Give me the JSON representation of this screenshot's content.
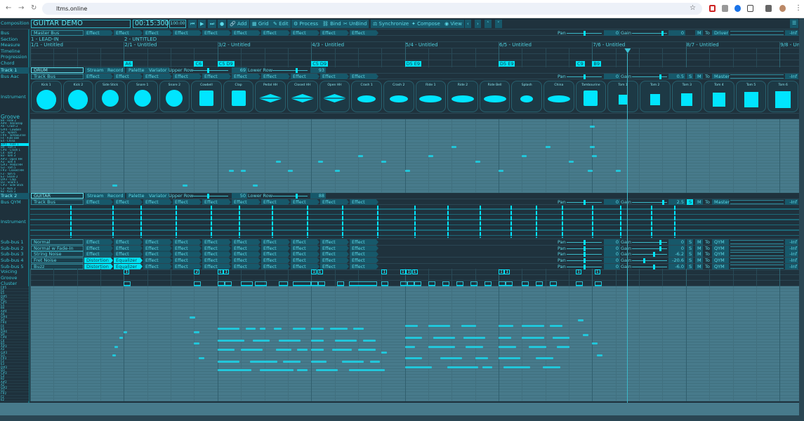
{
  "browser": {
    "url": "ltms.online"
  },
  "toolbar": {
    "label": "Composition",
    "title": "GUITAR DEMO",
    "time": "00:15:300",
    "tempo": "100.00",
    "buttons": [
      "Add",
      "Grid",
      "Edit",
      "Process",
      "Bind",
      "UnBind",
      "Synchronize",
      "Compose",
      "View"
    ]
  },
  "labels": {
    "bus": "Bus",
    "section": "Section",
    "measure": "Measure",
    "timeline": "Timeline",
    "progression": "Progression",
    "chord": "Chord",
    "track1": "Track 1",
    "busaac": "Bus Aac",
    "instrument": "Instrument",
    "groove": "Groove",
    "track2": "Track 2",
    "busqym": "Bus QYM",
    "instrument2": "Instrument",
    "voicing": "Voicing",
    "groove2": "Groove",
    "cluster": "Cluster"
  },
  "master_bus": {
    "name": "Master Bus",
    "effects": [
      "Effect",
      "Effect",
      "Effect",
      "Effect",
      "Effect",
      "Effect",
      "Effect",
      "Effect",
      "Effect",
      "Effect"
    ],
    "pan_label": "Pan",
    "pan": "0",
    "pan_frac": 0.5,
    "gain_label": "Gain",
    "gain": "0",
    "gain_frac": 0.85,
    "m": "M",
    "to": "To",
    "dest": "Driver",
    "level": "-Inf"
  },
  "sections": [
    "1 - LEAD-IN",
    "2 - UNTITLED"
  ],
  "measures": [
    "1/1 - Untitled",
    "2/1 - Untitled",
    "3/2 - Untitled",
    "4/3 - Untitled",
    "5/4 - Untitled",
    "6/5 - Untitled",
    "7/6 - Untitled",
    "8/7 - Untitled",
    "9/8 - Untitled"
  ],
  "playhead_beat": 25.5,
  "chords": [
    {
      "beat": 4,
      "name": "A6"
    },
    {
      "beat": 7,
      "name": "C6"
    },
    {
      "beat": 8,
      "name": "C5 D9"
    },
    {
      "beat": 12,
      "name": "C5 D9"
    },
    {
      "beat": 16,
      "name": "D5 E9"
    },
    {
      "beat": 20,
      "name": "D5 E9"
    },
    {
      "beat": 23.3,
      "name": "C9"
    },
    {
      "beat": 24,
      "name": "B9"
    }
  ],
  "track1": {
    "name": "DRUM",
    "buttons": [
      "Stream",
      "Record",
      "Palette",
      "Variator"
    ],
    "upper_label": "Upper Row",
    "upper": "69",
    "upper_frac": 0.4,
    "lower_label": "Lower Row",
    "lower": "93",
    "lower_frac": 0.65,
    "bus": {
      "name": "Track Bus",
      "effects": [
        "Effect",
        "Effect",
        "Effect",
        "Effect",
        "Effect",
        "Effect",
        "Effect",
        "Effect",
        "Effect",
        "Effect"
      ],
      "pan_label": "Pan",
      "pan": "0",
      "pan_frac": 0.5,
      "gain_label": "Gain",
      "gain": "0.5",
      "gain_frac": 0.8,
      "s": "S",
      "m": "M",
      "to": "To",
      "dest": "Master",
      "level": "-Inf"
    },
    "instruments": [
      {
        "name": "Kick 1",
        "shape": "kick"
      },
      {
        "name": "Kick 2",
        "shape": "kick"
      },
      {
        "name": "Side Stick",
        "shape": "snare"
      },
      {
        "name": "Snare 1",
        "shape": "snare"
      },
      {
        "name": "Snare 2",
        "shape": "snare"
      },
      {
        "name": "Cowbell",
        "shape": "block"
      },
      {
        "name": "Clap",
        "shape": "block"
      },
      {
        "name": "Pedal HH",
        "shape": "hh"
      },
      {
        "name": "Closed HH",
        "shape": "hh"
      },
      {
        "name": "Open HH",
        "shape": "hh"
      },
      {
        "name": "Crash 1",
        "shape": "cym"
      },
      {
        "name": "Crash 2",
        "shape": "cym"
      },
      {
        "name": "Ride 1",
        "shape": "cym"
      },
      {
        "name": "Ride 2",
        "shape": "cym"
      },
      {
        "name": "Ride Bell",
        "shape": "cym"
      },
      {
        "name": "Splash",
        "shape": "cym"
      },
      {
        "name": "China",
        "shape": "cym"
      },
      {
        "name": "Tambourine",
        "shape": "block"
      },
      {
        "name": "Tom 1",
        "shape": "tom"
      },
      {
        "name": "Tom 2",
        "shape": "tom"
      },
      {
        "name": "Tom 3",
        "shape": "tom"
      },
      {
        "name": "Tom 4",
        "shape": "tom"
      },
      {
        "name": "Tom 5",
        "shape": "tom"
      },
      {
        "name": "Tom 6",
        "shape": "tom"
      }
    ],
    "groove_rows": [
      "B4 - Ride 2",
      "A#4 - Vibraslap",
      "A4 - Crash 2",
      "G#4 - Cowbell",
      "G4 - Splash",
      "F#4 - Tambourine",
      "F4 - Ride Bell",
      "E4 - China",
      "D#4 - Ride 1",
      "D4 - Tom 1",
      "C#4 - Crash 1",
      "C4 - Tom 2",
      "B3 - Tom 3",
      "A#3 - Open HH",
      "A3 - Tom 4",
      "G#3 - Pedal HH",
      "G3 - Tom 5",
      "F#3 - Closed HH",
      "F3 - Tom 6",
      "E3 - Snare 2",
      "D#3 - Clap",
      "D3 - Snare 1",
      "C#3 - Side Stick",
      "C3 - Kick 2",
      "B2 - Kick 1"
    ],
    "selected_row": 8,
    "notes": [
      [
        3.5,
        22
      ],
      [
        6.5,
        22
      ],
      [
        9.5,
        22
      ],
      [
        8.5,
        17
      ],
      [
        9,
        17
      ],
      [
        10.5,
        14
      ],
      [
        11,
        17
      ],
      [
        12.3,
        14
      ],
      [
        13,
        17
      ],
      [
        14,
        12
      ],
      [
        15,
        14
      ],
      [
        16,
        17
      ],
      [
        17,
        12
      ],
      [
        18,
        9
      ],
      [
        19,
        14
      ],
      [
        20,
        17
      ],
      [
        21,
        12
      ],
      [
        22,
        9
      ],
      [
        23,
        14
      ],
      [
        23.8,
        17
      ],
      [
        23.9,
        9
      ],
      [
        23.9,
        2
      ],
      [
        24,
        12
      ],
      [
        25,
        17
      ]
    ]
  },
  "track2": {
    "name": "GUITAR",
    "buttons": [
      "Stream",
      "Record",
      "Palette",
      "Variator"
    ],
    "upper_label": "Upper Row",
    "upper": "50",
    "upper_frac": 0.4,
    "lower_label": "Lower Row",
    "lower": "88",
    "lower_frac": 0.65,
    "bus": {
      "name": "Track Bus",
      "effects": [
        "Effect",
        "Effect",
        "Effect",
        "Effect",
        "Effect",
        "Effect",
        "Effect",
        "Effect",
        "Effect",
        "Effect"
      ],
      "pan_label": "Pan",
      "pan": "0",
      "pan_frac": 0.5,
      "gain_label": "Gain",
      "gain": "2.5",
      "gain_frac": 0.88,
      "s": "S",
      "s_active": true,
      "m": "M",
      "to": "To",
      "dest": "Master",
      "level": "-Inf"
    },
    "strings": 6,
    "fret_beats": [
      1.7,
      3.5,
      4.7,
      6.2,
      7.7,
      8.9,
      10.3,
      11.8,
      13.3,
      14.8,
      16.4,
      17.8,
      19.2,
      20.5,
      21.6,
      22.7,
      24,
      25.2,
      26.5,
      27.5
    ],
    "subbuses": [
      {
        "label": "Sub-bus 1",
        "name": "Normal",
        "effects": [
          "Effect",
          "Effect",
          "Effect",
          "Effect",
          "Effect",
          "Effect",
          "Effect",
          "Effect",
          "Effect",
          "Effect"
        ],
        "active": 0,
        "pan": "0",
        "pan_frac": 0.5,
        "gain": "0",
        "gain_frac": 0.8,
        "dest": "QYM",
        "level": "-Inf"
      },
      {
        "label": "Sub-bus 2",
        "name": "Normal w Fade-In",
        "effects": [
          "Effect",
          "Effect",
          "Effect",
          "Effect",
          "Effect",
          "Effect",
          "Effect",
          "Effect",
          "Effect",
          "Effect"
        ],
        "active": 0,
        "pan": "0",
        "pan_frac": 0.5,
        "gain": "0",
        "gain_frac": 0.8,
        "dest": "QYM",
        "level": "-Inf"
      },
      {
        "label": "Sub-bus 3",
        "name": "String Noise",
        "effects": [
          "Effect",
          "Effect",
          "Effect",
          "Effect",
          "Effect",
          "Effect",
          "Effect",
          "Effect",
          "Effect",
          "Effect"
        ],
        "active": 0,
        "pan": "0",
        "pan_frac": 0.5,
        "gain": "-6.2",
        "gain_frac": 0.62,
        "dest": "QYM",
        "level": "-Inf"
      },
      {
        "label": "Sub-bus 4",
        "name": "Fret Noise",
        "effects": [
          "Distortion",
          "Equalizer",
          "Effect",
          "Effect",
          "Effect",
          "Effect",
          "Effect",
          "Effect",
          "Effect",
          "Effect"
        ],
        "active": 2,
        "pan": "0",
        "pan_frac": 0.5,
        "gain": "-20.6",
        "gain_frac": 0.33,
        "dest": "QYM",
        "level": "-Inf"
      },
      {
        "label": "Sub-bus 5",
        "name": "Buzz",
        "effects": [
          "Distortion",
          "Equalizer",
          "Effect",
          "Effect",
          "Effect",
          "Effect",
          "Effect",
          "Effect",
          "Effect",
          "Effect"
        ],
        "active": 2,
        "pan": "0",
        "pan_frac": 0.5,
        "gain": "-6.0",
        "gain_frac": 0.62,
        "dest": "QYM",
        "level": "-Inf"
      }
    ],
    "sub_labels": {
      "pan": "Pan",
      "gain": "Gain",
      "s": "S",
      "m": "M",
      "to": "To"
    },
    "voicings": [
      [
        4,
        "1"
      ],
      [
        7,
        "2"
      ],
      [
        8,
        "1"
      ],
      [
        8.25,
        "1"
      ],
      [
        12,
        "1"
      ],
      [
        12.25,
        "1"
      ],
      [
        15,
        "1"
      ],
      [
        15.8,
        "1"
      ],
      [
        16.05,
        "1"
      ],
      [
        16.3,
        "1"
      ],
      [
        20,
        "1"
      ],
      [
        20.25,
        "1"
      ],
      [
        23.3,
        "1"
      ],
      [
        24.1,
        "1"
      ]
    ],
    "clusters": [
      [
        4,
        0.3
      ],
      [
        7,
        0.3
      ],
      [
        8,
        0.3
      ],
      [
        8.3,
        0.3
      ],
      [
        9,
        0.5
      ],
      [
        9.6,
        0.5
      ],
      [
        10.6,
        0.4
      ],
      [
        11.2,
        0.8
      ],
      [
        12,
        0.3
      ],
      [
        12.3,
        0.3
      ],
      [
        13.1,
        0.3
      ],
      [
        13.6,
        1.2
      ],
      [
        15,
        0.3
      ],
      [
        15.8,
        0.3
      ],
      [
        16.1,
        0.3
      ],
      [
        16.4,
        0.3
      ],
      [
        17,
        0.3
      ],
      [
        17.6,
        0.3
      ],
      [
        18.2,
        0.3
      ],
      [
        18.8,
        0.3
      ],
      [
        19.4,
        0.3
      ],
      [
        20,
        0.3
      ],
      [
        20.3,
        0.3
      ],
      [
        21,
        0.3
      ],
      [
        21.6,
        0.3
      ],
      [
        22.2,
        0.3
      ],
      [
        23.3,
        0.3
      ],
      [
        24.1,
        0.3
      ]
    ],
    "piano_rows": [
      "F#5",
      "F5",
      "E5",
      "D#5",
      "D5",
      "C#5",
      "C5",
      "B4",
      "A#4",
      "A4",
      "G#4",
      "G4",
      "F#4",
      "F4",
      "E4",
      "D#4",
      "D4",
      "C#4",
      "C4",
      "B3",
      "A#3",
      "A3",
      "G#3",
      "G3",
      "F#3",
      "F3",
      "E3",
      "D#3",
      "D3",
      "C#3",
      "C3",
      "B2",
      "A#2",
      "A2",
      "G#2",
      "G2",
      "F#2",
      "F2",
      "E2"
    ],
    "notes": [
      [
        4,
        15,
        0.2
      ],
      [
        3.8,
        17,
        0.2
      ],
      [
        3.6,
        20,
        0.2
      ],
      [
        3.5,
        23,
        0.2
      ],
      [
        6.8,
        10,
        0.3
      ],
      [
        7,
        15,
        0.3
      ],
      [
        7,
        19,
        0.3
      ],
      [
        7.2,
        24,
        0.3
      ],
      [
        8,
        14,
        1
      ],
      [
        9.2,
        14,
        0.5
      ],
      [
        9.8,
        14,
        0.3
      ],
      [
        10.4,
        14,
        0.4
      ],
      [
        11.2,
        14,
        0.6
      ],
      [
        8,
        18,
        1.2
      ],
      [
        9.5,
        18,
        0.8
      ],
      [
        10.6,
        18,
        1
      ],
      [
        8,
        21,
        0.8
      ],
      [
        9,
        21,
        1
      ],
      [
        10.5,
        21,
        0.7
      ],
      [
        11.4,
        21,
        0.5
      ],
      [
        8,
        25,
        1
      ],
      [
        9.4,
        25,
        1.2
      ],
      [
        10.8,
        25,
        0.8
      ],
      [
        8,
        28,
        1.5
      ],
      [
        9.8,
        28,
        1.5
      ],
      [
        11.4,
        28,
        0.5
      ],
      [
        12,
        14,
        0.6
      ],
      [
        12.8,
        14,
        0.8
      ],
      [
        13.8,
        14,
        0.5
      ],
      [
        12,
        18,
        0.6
      ],
      [
        13,
        18,
        1
      ],
      [
        14.2,
        18,
        0.6
      ],
      [
        12,
        21,
        0.6
      ],
      [
        12.9,
        21,
        0.9
      ],
      [
        14,
        21,
        0.8
      ],
      [
        12,
        25,
        0.7
      ],
      [
        13.3,
        25,
        1
      ],
      [
        14.5,
        25,
        0.5
      ],
      [
        12.2,
        28,
        1
      ],
      [
        13.6,
        28,
        1.6
      ],
      [
        15,
        22,
        0.3
      ],
      [
        16,
        13,
        0.6
      ],
      [
        17,
        13,
        1
      ],
      [
        18.4,
        13,
        0.7
      ],
      [
        16,
        17,
        0.8
      ],
      [
        17.2,
        17,
        1
      ],
      [
        18.5,
        17,
        1
      ],
      [
        16,
        20,
        0.5
      ],
      [
        17,
        20,
        1.2
      ],
      [
        18.6,
        20,
        0.8
      ],
      [
        16,
        24,
        0.8
      ],
      [
        17.5,
        24,
        1
      ],
      [
        19,
        24,
        0.6
      ],
      [
        16,
        27,
        1.2
      ],
      [
        17.8,
        27,
        1.4
      ],
      [
        19.3,
        27,
        0.5
      ],
      [
        20,
        13,
        0.7
      ],
      [
        21,
        13,
        1
      ],
      [
        22.2,
        13,
        0.6
      ],
      [
        20,
        17,
        0.6
      ],
      [
        21,
        17,
        1
      ],
      [
        22.3,
        17,
        0.8
      ],
      [
        20,
        20,
        0.8
      ],
      [
        21.3,
        20,
        0.8
      ],
      [
        22.5,
        20,
        0.6
      ],
      [
        20,
        24,
        1
      ],
      [
        21.6,
        24,
        0.8
      ],
      [
        20.2,
        27,
        1.2
      ],
      [
        21.9,
        27,
        0.8
      ],
      [
        23.4,
        11,
        0.3
      ],
      [
        23.6,
        16,
        0.3
      ],
      [
        24,
        19,
        0.3
      ],
      [
        24.2,
        23,
        0.3
      ]
    ]
  },
  "colors": {
    "accent": "#00e5ff",
    "bg": "#1e313c",
    "chip": "#17586a",
    "grid": "#477a8b"
  }
}
